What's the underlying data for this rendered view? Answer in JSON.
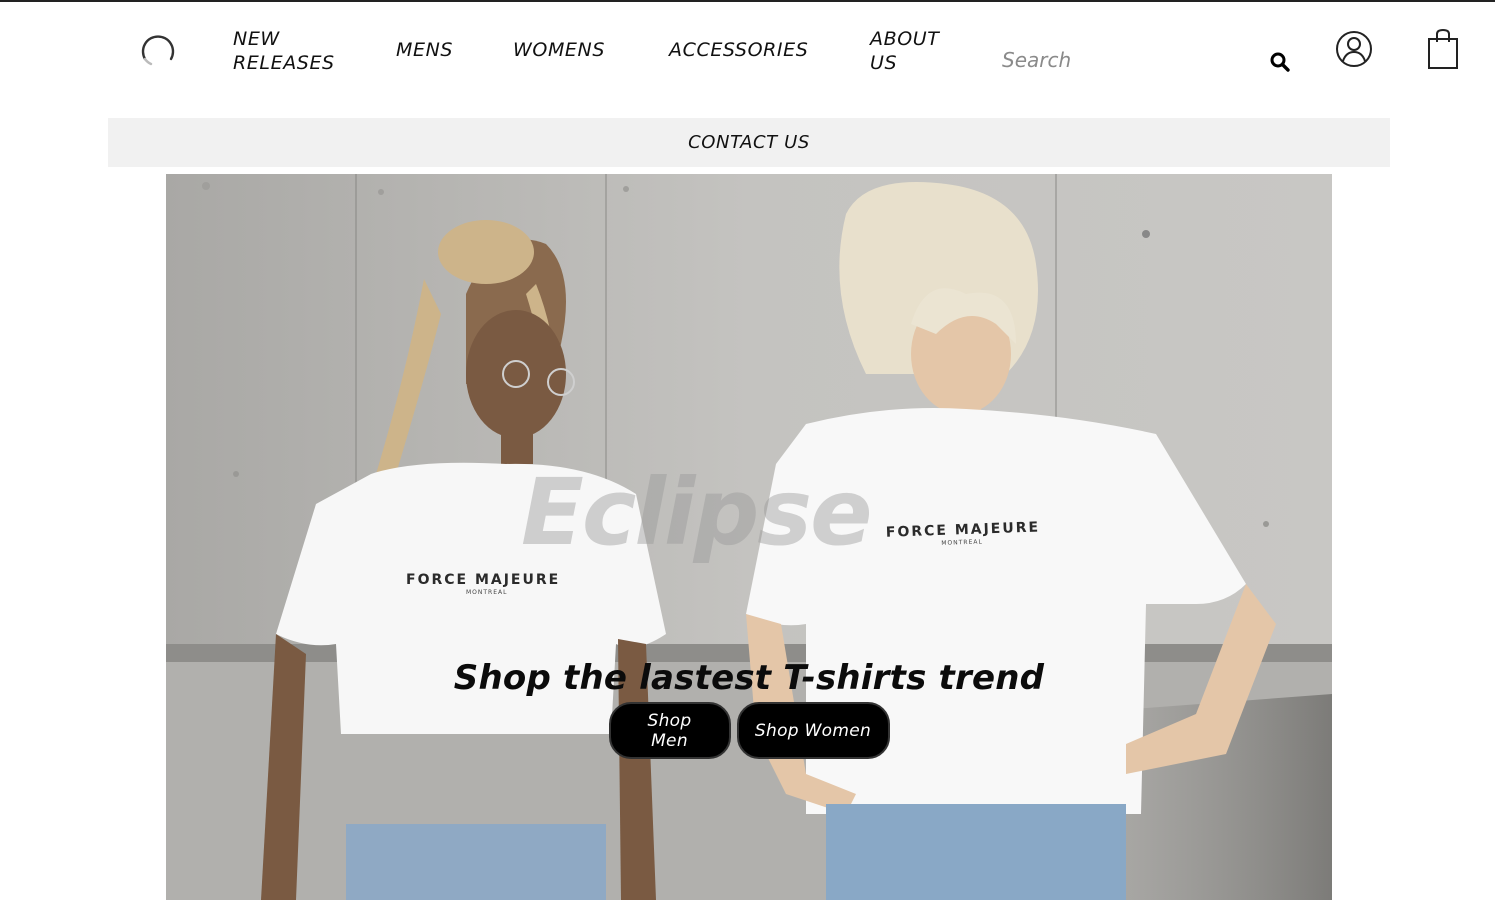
{
  "nav": {
    "new_releases_line1": "NEW",
    "new_releases_line2": "RELEASES",
    "mens": "MENS",
    "womens": "WOMENS",
    "accessories": "ACCESSORIES",
    "about_line1": "ABOUT",
    "about_line2": "US",
    "contact": "CONTACT US"
  },
  "search": {
    "placeholder": "Search"
  },
  "icons": {
    "logo": "loading-circle-logo",
    "search": "search-icon",
    "account": "user-icon",
    "cart": "shopping-bag-icon"
  },
  "hero": {
    "watermark": "Eclipse",
    "tagline": "Shop the lastest T-shirts trend",
    "shop_men": "Shop Men",
    "shop_women": "Shop Women",
    "shirt_brand": "FORCE MAJEURE",
    "shirt_city": "MONTREAL"
  },
  "colors": {
    "button_bg": "#000000",
    "contact_bar_bg": "#f1f1f1",
    "hero_wall": "#b9b8b5"
  }
}
